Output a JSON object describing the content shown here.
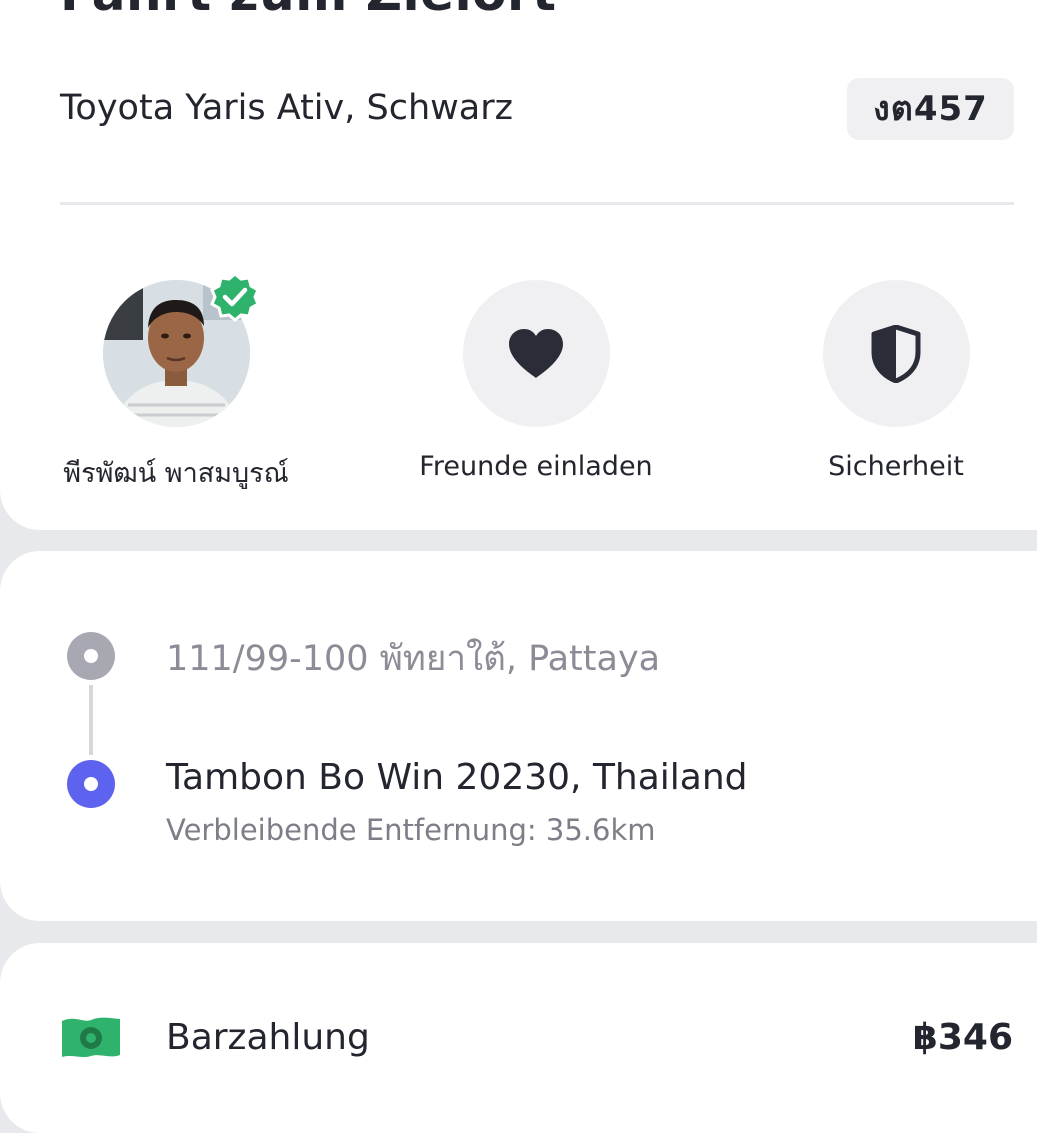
{
  "trip": {
    "title": "Fahrt zum Zielort",
    "vehicle": "Toyota Yaris Ativ, Schwarz",
    "plate": "งต457"
  },
  "actions": {
    "driver_name": "พีรพัฒน์ พาสมบูรณ์",
    "invite_label": "Freunde einladen",
    "safety_label": "Sicherheit"
  },
  "route": {
    "origin": "111/99-100 พัทยาใต้, Pattaya",
    "destination": "Tambon Bo Win 20230, Thailand",
    "remaining": "Verbleibende Entfernung: 35.6km"
  },
  "payment": {
    "method": "Barzahlung",
    "amount": "฿346"
  },
  "icons": {
    "verified": "verified-badge-icon",
    "heart": "heart-icon",
    "shield": "shield-icon",
    "cash": "cash-icon"
  },
  "colors": {
    "accent": "#5e63ef",
    "success": "#2fb36c",
    "text": "#23252f",
    "muted": "#8b8c96",
    "chip_bg": "#f0f0f3"
  }
}
